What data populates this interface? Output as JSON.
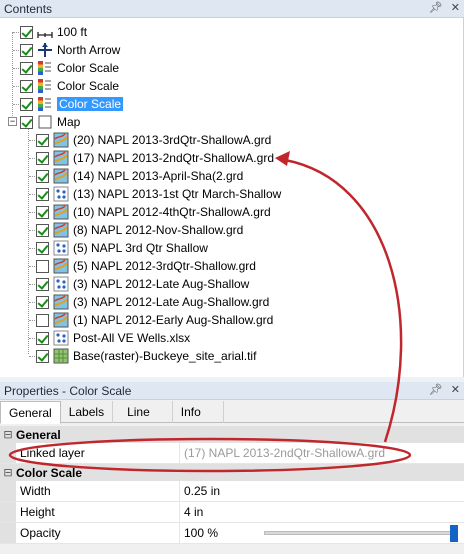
{
  "contents": {
    "title": "Contents",
    "pin_icon": "pin-icon",
    "close_icon": "close-icon",
    "items": [
      {
        "label": "100 ft",
        "icon": "scale-bar-icon",
        "checked": true
      },
      {
        "label": "North Arrow",
        "icon": "north-arrow-icon",
        "checked": true
      },
      {
        "label": "Color Scale",
        "icon": "color-scale-icon",
        "checked": true
      },
      {
        "label": "Color Scale",
        "icon": "color-scale-icon",
        "checked": true
      },
      {
        "label": "Color Scale",
        "icon": "color-scale-icon",
        "checked": true,
        "selected": true
      },
      {
        "label": "Map",
        "icon": "map-frame-icon",
        "checked": true
      }
    ],
    "layers": [
      {
        "label": "(20) NAPL 2013-3rdQtr-ShallowA.grd",
        "icon": "contour-icon",
        "checked": true
      },
      {
        "label": "(17) NAPL 2013-2ndQtr-ShallowA.grd",
        "icon": "contour-icon",
        "checked": true
      },
      {
        "label": "(14) NAPL 2013-April-Sha(2.grd",
        "icon": "contour-icon",
        "checked": true
      },
      {
        "label": "(13) NAPL 2013-1st Qtr March-Shallow",
        "icon": "post-icon",
        "checked": true
      },
      {
        "label": "(10) NAPL 2012-4thQtr-ShallowA.grd",
        "icon": "contour-icon",
        "checked": true
      },
      {
        "label": "(8) NAPL 2012-Nov-Shallow.grd",
        "icon": "contour-icon",
        "checked": true
      },
      {
        "label": "(5) NAPL 3rd Qtr Shallow",
        "icon": "post-icon",
        "checked": true
      },
      {
        "label": "(5) NAPL 2012-3rdQtr-Shallow.grd",
        "icon": "contour-icon",
        "checked": false
      },
      {
        "label": "(3) NAPL 2012-Late Aug-Shallow",
        "icon": "post-icon",
        "checked": true
      },
      {
        "label": "(3) NAPL 2012-Late Aug-Shallow.grd",
        "icon": "contour-icon",
        "checked": true
      },
      {
        "label": "(1) NAPL 2012-Early Aug-Shallow.grd",
        "icon": "contour-icon",
        "checked": false
      },
      {
        "label": "Post-All VE Wells.xlsx",
        "icon": "post-icon",
        "checked": true
      },
      {
        "label": "Base(raster)-Buckeye_site_arial.tif",
        "icon": "raster-icon",
        "checked": true
      }
    ]
  },
  "properties": {
    "title": "Properties - Color Scale",
    "tabs": [
      "General",
      "Labels",
      "Line",
      "Info"
    ],
    "active_tab": "General",
    "general": {
      "category": "General",
      "linked_layer_label": "Linked layer",
      "linked_layer_value": "(17) NAPL 2013-2ndQtr-ShallowA.grd"
    },
    "color_scale": {
      "category": "Color Scale",
      "width_label": "Width",
      "width_value": "0.25 in",
      "height_label": "Height",
      "height_value": "4 in",
      "opacity_label": "Opacity",
      "opacity_value": "100 %",
      "opacity_fraction": 1.0
    }
  },
  "colors": {
    "header_bg": "#dfe7f2",
    "selection": "#3399ff",
    "annotation": "#c0272d",
    "slider_thumb": "#1464c8"
  }
}
